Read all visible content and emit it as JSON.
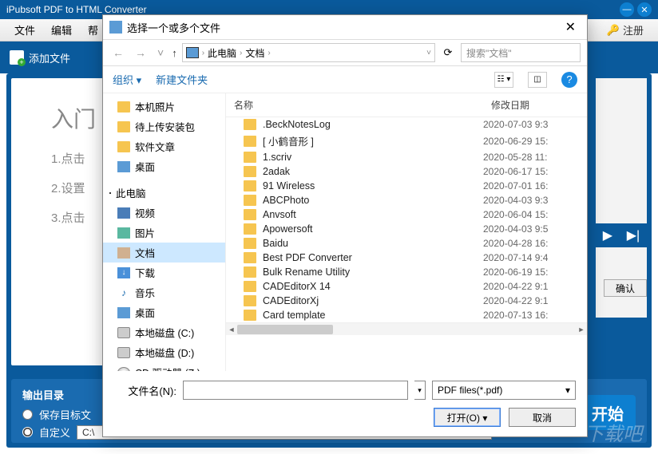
{
  "app": {
    "title": "iPubsoft PDF to HTML Converter",
    "menu": {
      "file": "文件",
      "edit": "编辑",
      "help": "帮"
    },
    "register": "注册",
    "add_files": "添加文件",
    "intro_title": "入门",
    "steps": {
      "s1": "1.点击",
      "s2": "2.设置",
      "s3": "3.点击"
    },
    "confirm": "确认",
    "output": {
      "label": "输出目录",
      "opt1": "保存目标文",
      "opt2": "自定义",
      "path": "C:\\"
    },
    "start": "开始"
  },
  "dialog": {
    "title": "选择一个或多个文件",
    "breadcrumb": {
      "root": "此电脑",
      "folder": "文档"
    },
    "search_placeholder": "搜索\"文档\"",
    "organize": "组织",
    "new_folder": "新建文件夹",
    "tree": {
      "local_photos": "本机照片",
      "pending_install": "待上传安装包",
      "software_articles": "软件文章",
      "desktop1": "桌面",
      "this_pc": "此电脑",
      "videos": "视频",
      "pictures": "图片",
      "documents": "文档",
      "downloads": "下载",
      "music": "音乐",
      "desktop2": "桌面",
      "disk_c": "本地磁盘 (C:)",
      "disk_d": "本地磁盘 (D:)",
      "cd": "CD 驱动器 (Z:)"
    },
    "columns": {
      "name": "名称",
      "modified": "修改日期"
    },
    "files": [
      {
        "name": ".BeckNotesLog",
        "date": "2020-07-03 9:3"
      },
      {
        "name": "[ 小鹤音形 ]",
        "date": "2020-06-29 15:"
      },
      {
        "name": "1.scriv",
        "date": "2020-05-28 11:"
      },
      {
        "name": "2adak",
        "date": "2020-06-17 15:"
      },
      {
        "name": "91 Wireless",
        "date": "2020-07-01 16:"
      },
      {
        "name": "ABCPhoto",
        "date": "2020-04-03 9:3"
      },
      {
        "name": "Anvsoft",
        "date": "2020-06-04 15:"
      },
      {
        "name": "Apowersoft",
        "date": "2020-04-03 9:5"
      },
      {
        "name": "Baidu",
        "date": "2020-04-28 16:"
      },
      {
        "name": "Best PDF Converter",
        "date": "2020-07-14 9:4"
      },
      {
        "name": "Bulk Rename Utility",
        "date": "2020-06-19 15:"
      },
      {
        "name": "CADEditorX 14",
        "date": "2020-04-22 9:1"
      },
      {
        "name": "CADEditorXj",
        "date": "2020-04-22 9:1"
      },
      {
        "name": "Card template",
        "date": "2020-07-13 16:"
      }
    ],
    "filename_label": "文件名(N):",
    "filter": "PDF files(*.pdf)",
    "open": "打开(O)",
    "cancel": "取消"
  },
  "watermark": "下载吧"
}
